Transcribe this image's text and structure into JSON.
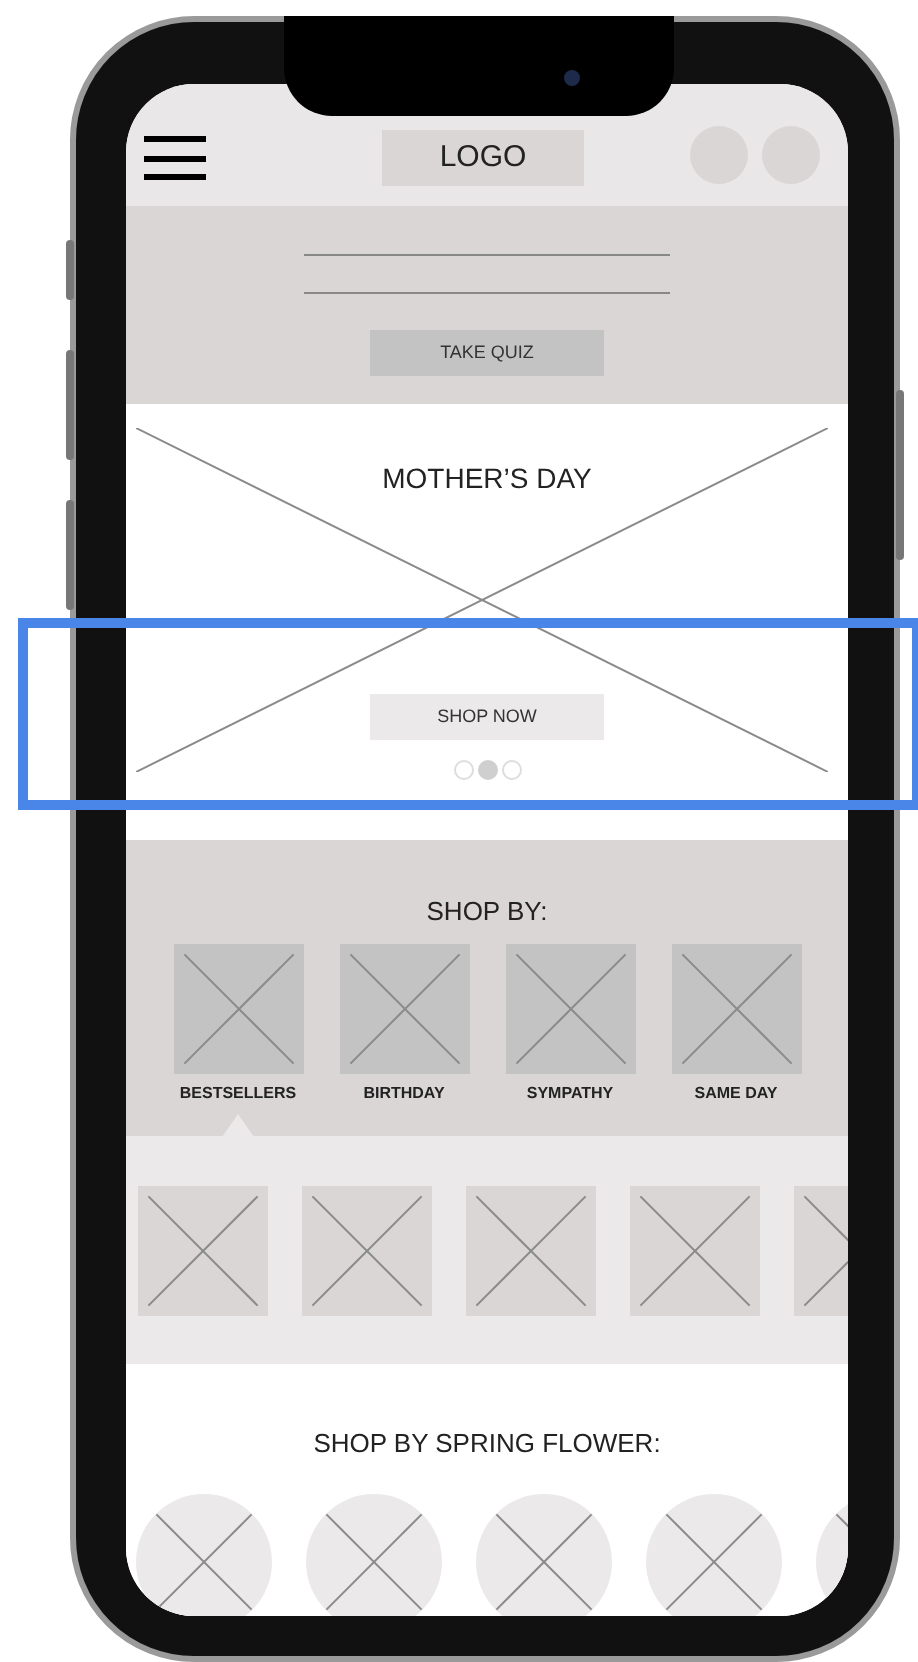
{
  "header": {
    "logo": "LOGO",
    "action_icons": [
      {
        "kind": "circle"
      },
      {
        "kind": "circle"
      }
    ]
  },
  "quiz_banner": {
    "button": "TAKE QUIZ"
  },
  "hero": {
    "title": "MOTHER’S DAY",
    "button": "SHOP NOW",
    "carousel_dots": [
      {
        "selected": false
      },
      {
        "selected": true
      },
      {
        "selected": false
      }
    ]
  },
  "shop_by": {
    "title": "SHOP BY:",
    "categories": [
      {
        "label": "BESTSELLERS",
        "selected": true
      },
      {
        "label": "BIRTHDAY",
        "selected": false
      },
      {
        "label": "SYMPATHY",
        "selected": false
      },
      {
        "label": "SAME DAY",
        "selected": false
      }
    ],
    "products": [
      {
        "kind": "placeholder"
      },
      {
        "kind": "placeholder"
      },
      {
        "kind": "placeholder"
      },
      {
        "kind": "placeholder"
      },
      {
        "kind": "placeholder"
      }
    ]
  },
  "spring_flowers": {
    "title": "SHOP BY SPRING FLOWER:",
    "items": [
      {
        "kind": "placeholder"
      },
      {
        "kind": "placeholder"
      },
      {
        "kind": "placeholder"
      },
      {
        "kind": "placeholder"
      },
      {
        "kind": "placeholder"
      }
    ]
  }
}
